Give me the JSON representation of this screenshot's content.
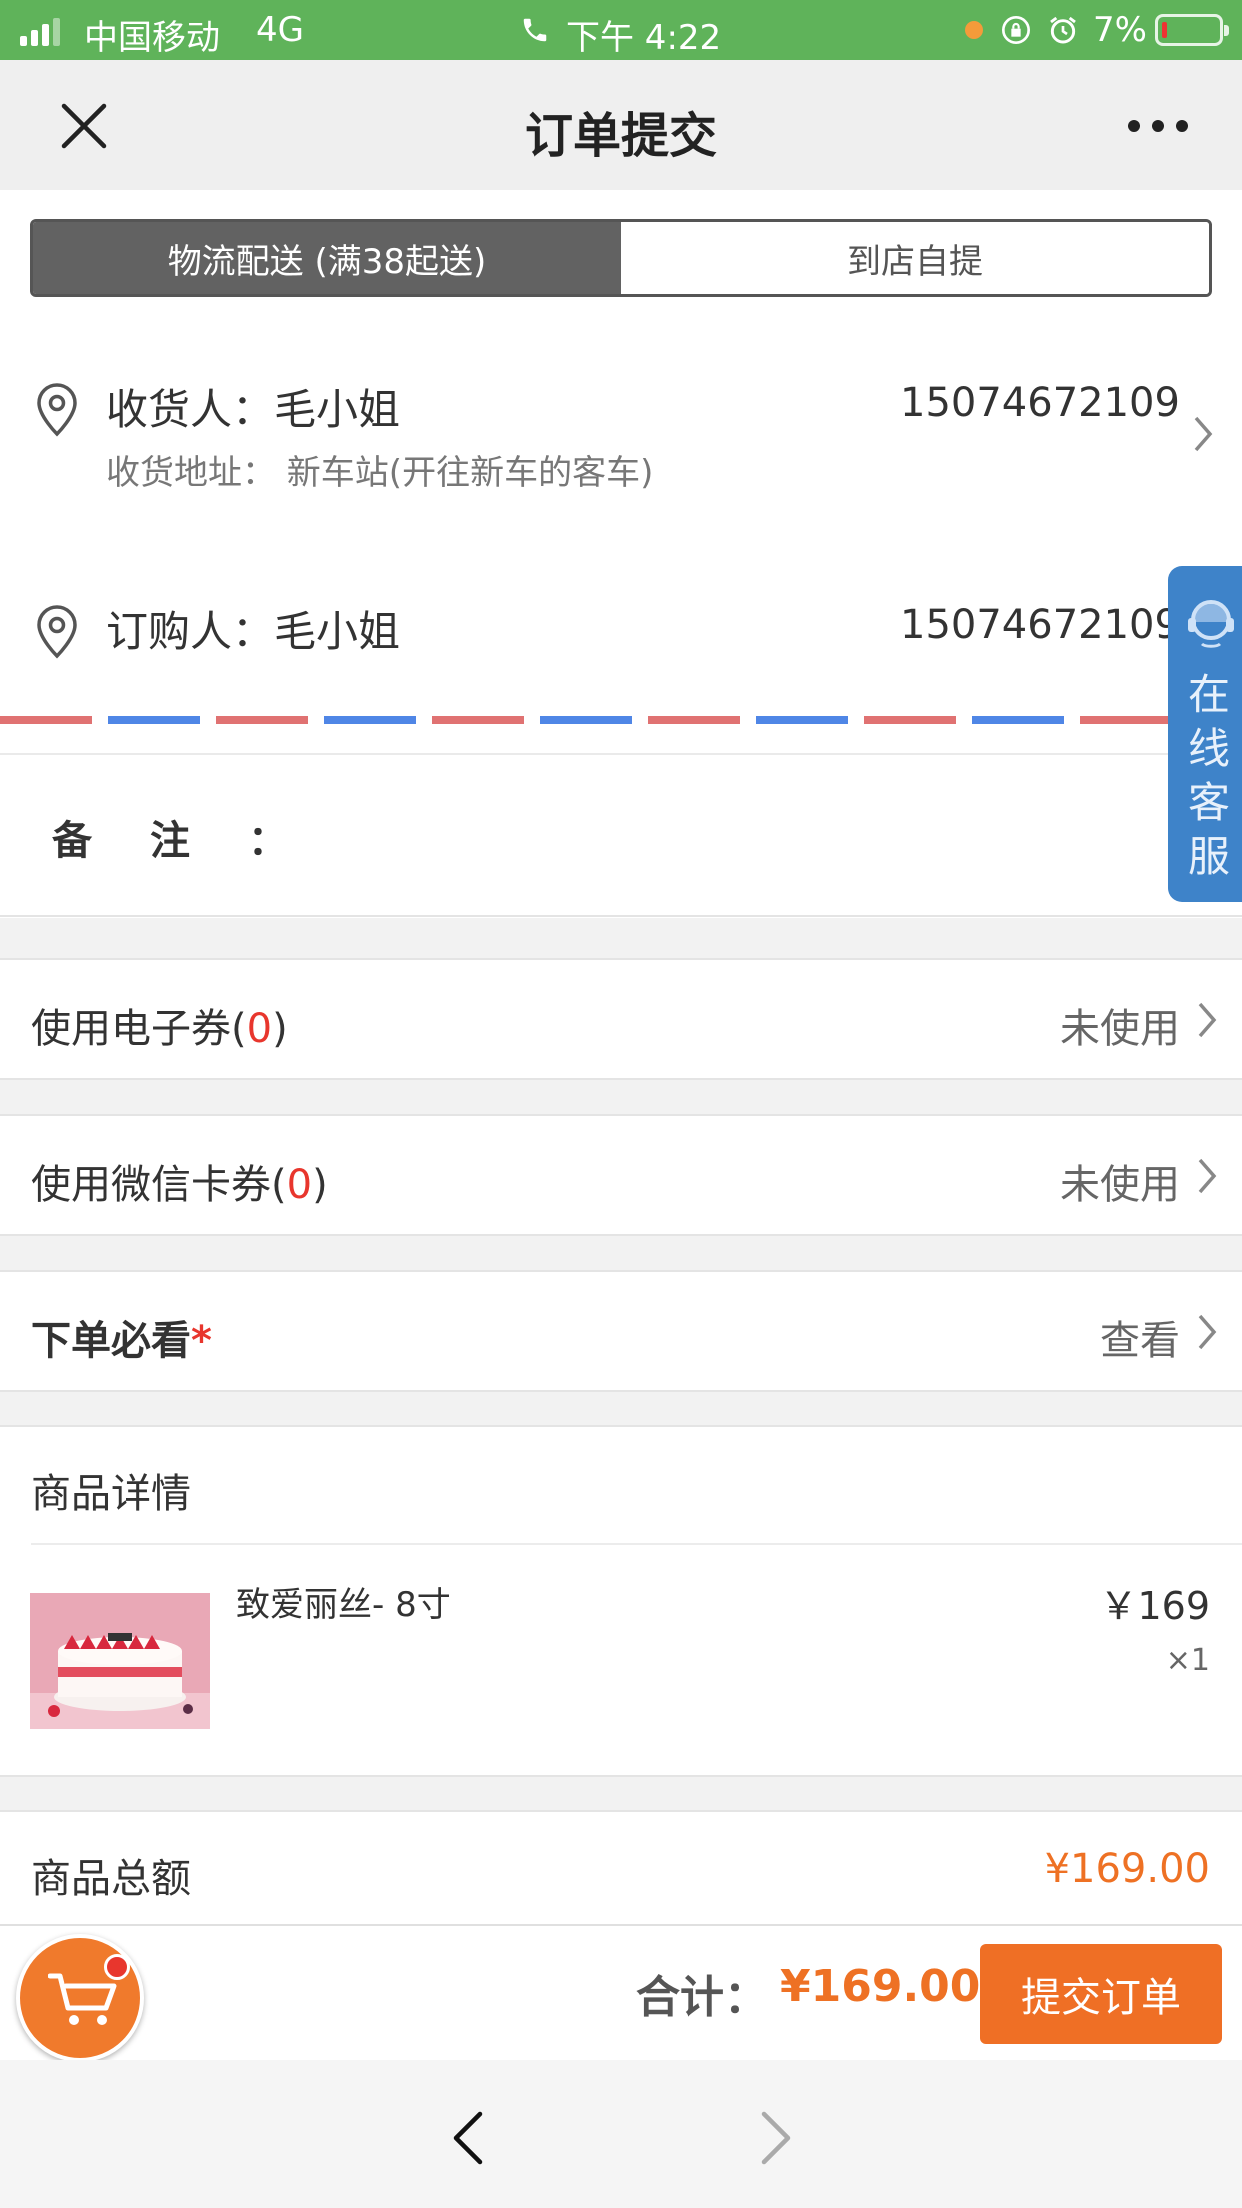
{
  "status_bar": {
    "carrier": "中国移动",
    "network": "4G",
    "time": "下午 4:22",
    "battery_pct": "7%",
    "battery_level": 0.07
  },
  "nav": {
    "title": "订单提交",
    "close_icon": "close-icon",
    "more_icon": "more-icon"
  },
  "delivery_tabs": {
    "selected": "物流配送 (满38起送)",
    "options": [
      "物流配送 (满38起送)",
      "到店自提"
    ]
  },
  "receiver": {
    "label": "收货人：毛小姐",
    "phone": "15074672109",
    "address": "收货地址： 新车站(开往新车的客车)"
  },
  "buyer": {
    "label": "订购人：毛小姐",
    "phone": "15074672109"
  },
  "remark": {
    "label": "备注："
  },
  "service": {
    "label": "在线客服"
  },
  "coupons": {
    "e_coupon": {
      "label": "使用电子券(",
      "count": "0",
      "suffix": ")",
      "value": "未使用"
    },
    "wechat_card": {
      "label": "使用微信卡券(",
      "count": "0",
      "suffix": ")",
      "value": "未使用"
    }
  },
  "must_read": {
    "label": "下单必看",
    "required_mark": "*",
    "value": "查看"
  },
  "products": {
    "heading": "商品详情",
    "items": [
      {
        "name": "致爱丽丝- 8寸",
        "price": "￥169",
        "quantity": "×1"
      }
    ]
  },
  "subtotal": {
    "label": "商品总额",
    "amount": "¥169.00"
  },
  "checkout": {
    "total_label": "合计：",
    "total_amount": "¥169.00",
    "submit_label": "提交订单"
  },
  "colors": {
    "status_bar": "#5fb35a",
    "accent_orange": "#ef6f25",
    "price_orange": "#ee7124",
    "red": "#e8362d",
    "service_blue": "#3e83c9"
  }
}
